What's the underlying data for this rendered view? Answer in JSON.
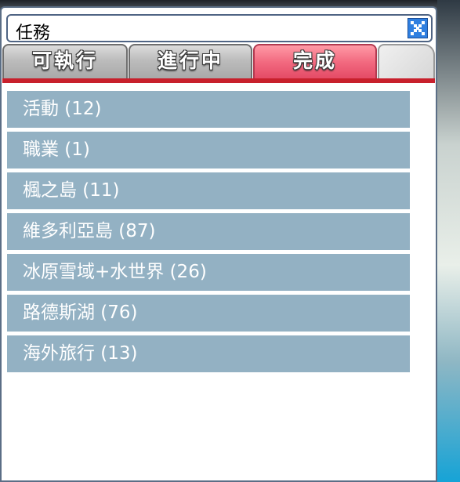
{
  "window": {
    "title": "任務",
    "close_icon": "close-icon"
  },
  "tabs": [
    {
      "label": "可執行",
      "active": false
    },
    {
      "label": "進行中",
      "active": false
    },
    {
      "label": "完成",
      "active": true
    },
    {
      "label": "",
      "active": false
    }
  ],
  "colors": {
    "active_tab": "#f26a80",
    "inactive_tab": "#b4b4b4",
    "tab_underline": "#c8202c",
    "list_item_bg": "#93b1c3",
    "window_border": "#5b6e86"
  },
  "quest_categories": [
    {
      "label": "活動 (12)"
    },
    {
      "label": "職業 (1)"
    },
    {
      "label": "楓之島 (11)"
    },
    {
      "label": "維多利亞島 (87)"
    },
    {
      "label": "冰原雪域+水世界 (26)"
    },
    {
      "label": "路德斯湖 (76)"
    },
    {
      "label": "海外旅行 (13)"
    }
  ]
}
